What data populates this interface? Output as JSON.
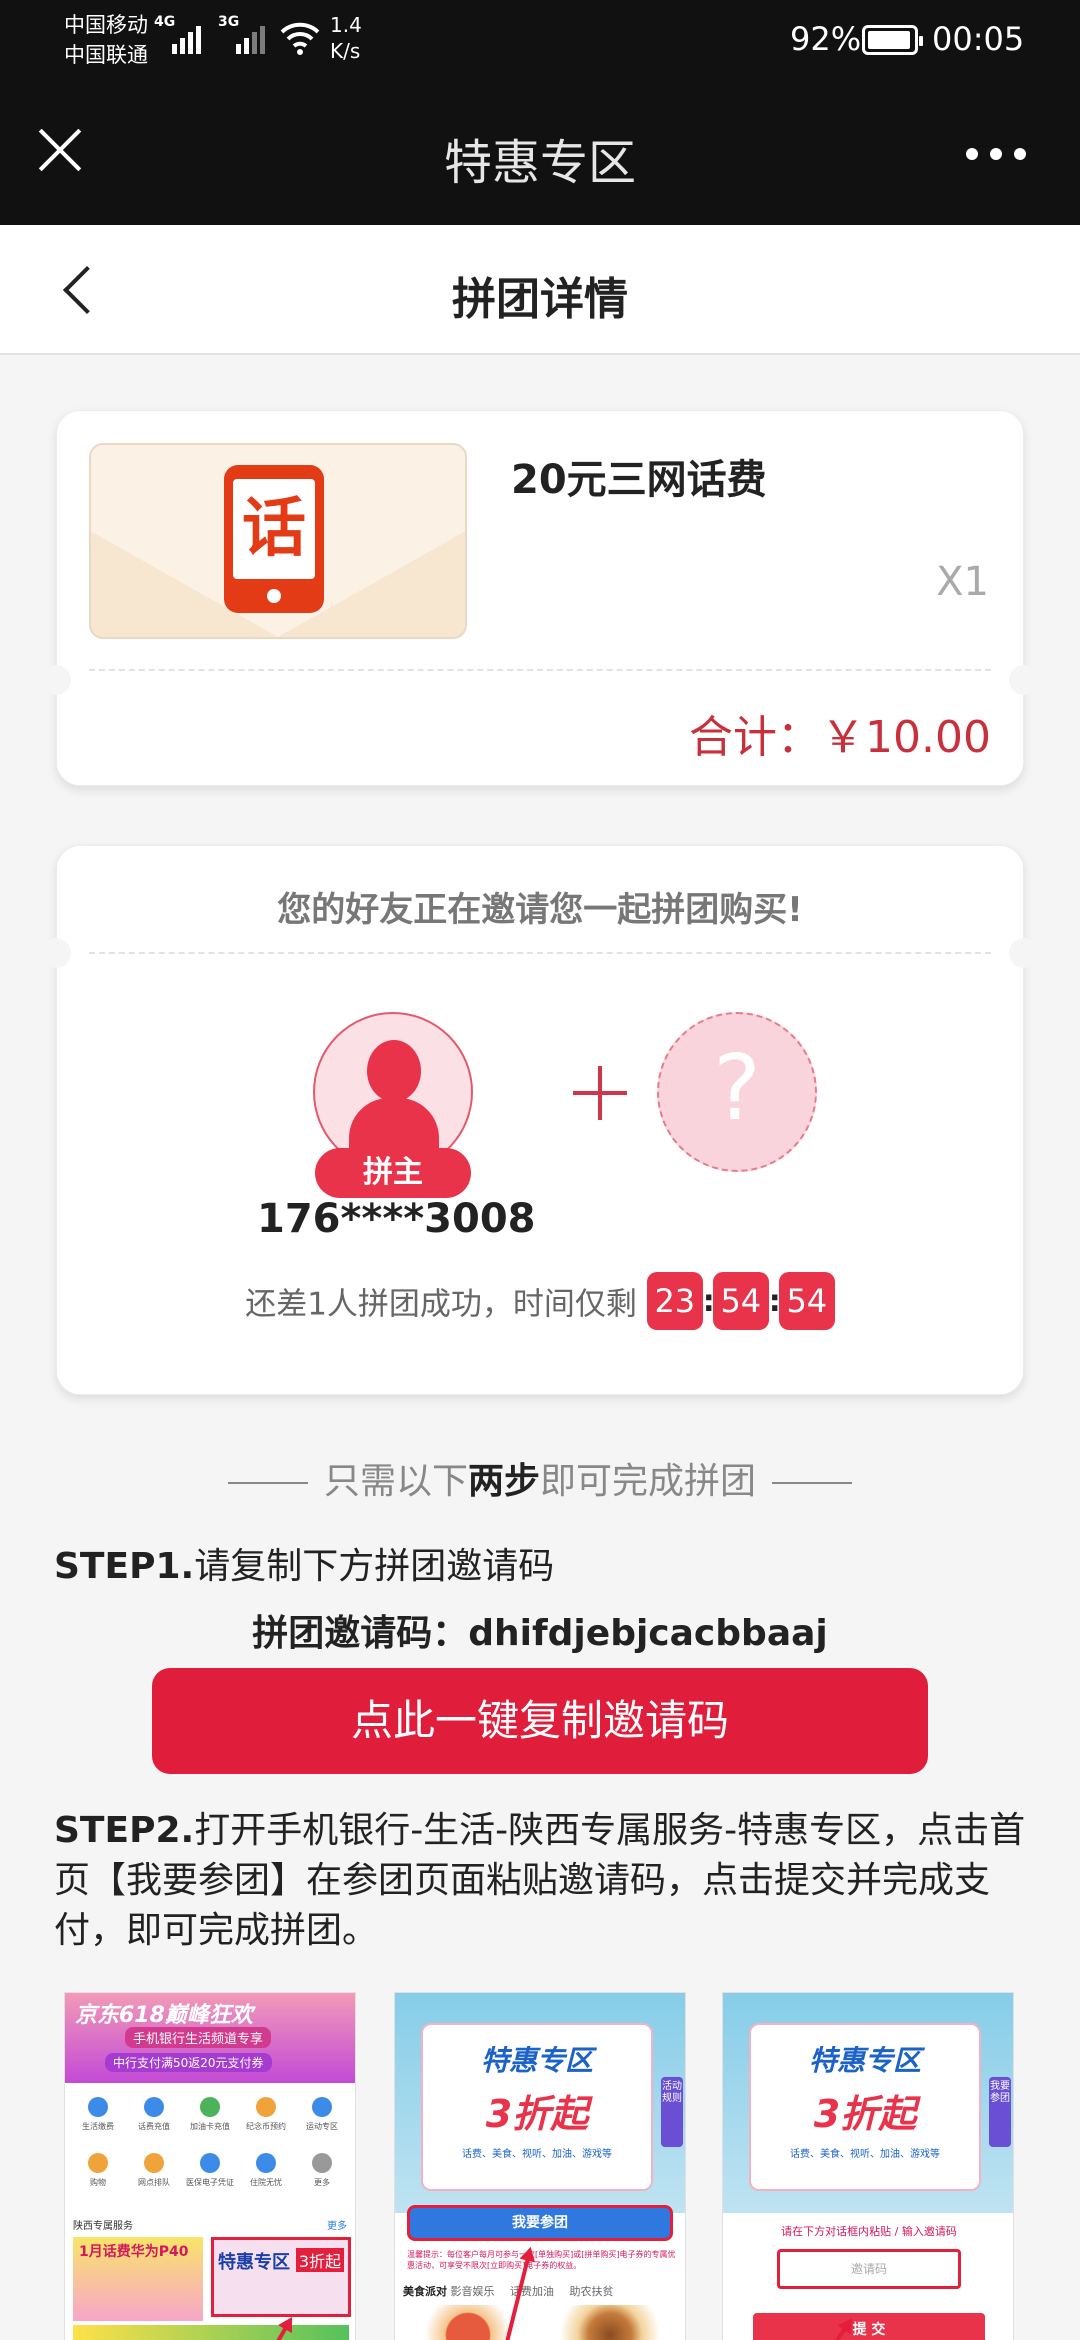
{
  "status_bar": {
    "carrier_1": "中国移动",
    "carrier_2": "中国联通",
    "network_1": "4G",
    "network_2": "3G",
    "speed_value": "1.4",
    "speed_unit": "K/s",
    "battery": "92%",
    "time": "00:05"
  },
  "app_header": {
    "title": "特惠专区"
  },
  "page_header": {
    "title": "拼团详情"
  },
  "product": {
    "name": "20元三网话费",
    "image_char": "话",
    "quantity": "X1",
    "total": "合计：￥10.00"
  },
  "group": {
    "invite_text": "您的好友正在邀请您一起拼团购买!",
    "leader_badge": "拼主",
    "leader_phone": "176****3008",
    "empty_slot": "?",
    "countdown_label": "还差1人拼团成功，时间仅剩",
    "countdown": {
      "hours": "23",
      "minutes": "54",
      "seconds": "54"
    }
  },
  "steps": {
    "heading_pre": "只需以下",
    "heading_bold": "两步",
    "heading_post": "即可完成拼团",
    "step1_label": "STEP1.",
    "step1_text": "请复制下方拼团邀请码",
    "invite_code_label": "拼团邀请码：",
    "invite_code": "dhifdjebjcacbbaaj",
    "copy_button": "点此一键复制邀请码",
    "step2_label": "STEP2.",
    "step2_text": "打开手机银行-生活-陕西专属服务-特惠专区，点击首页【我要参团】在参团页面粘贴邀请码，点击提交并完成支付，即可完成拼团。"
  },
  "screenshots": {
    "shot1": {
      "banner_title": "京东618巅峰狂欢",
      "banner_sub": "手机银行生活频道专享",
      "banner_sub2": "中行支付满50返20元支付券",
      "grid": [
        "生活缴费",
        "话费充值",
        "加油卡充值",
        "纪念币预约",
        "运动专区",
        "购物",
        "网点排队",
        "医保电子凭证",
        "住院无忧",
        "更多"
      ],
      "section": "陕西专属服务",
      "more": "更多",
      "banner2": "1月话费华为P40",
      "banner3_a": "特惠专区",
      "banner3_b": "3折起"
    },
    "shot2": {
      "title_a": "特惠专区",
      "title_b": "3折起",
      "subtitle": "话费、美食、视听、加油、游戏等",
      "side_tag": "活动规则",
      "join_button": "我要参团",
      "tip": "温馨提示：每位客户每月可参与一次[单独购买]或[拼单购买]电子券的专属优惠活动，可享受不限次[立即购买]电子券的权益。",
      "tabs": [
        "美食派对",
        "影音娱乐",
        "话费加油",
        "助农扶贫"
      ]
    },
    "shot3": {
      "title_a": "特惠专区",
      "title_b": "3折起",
      "subtitle": "话费、美食、视听、加油、游戏等",
      "side_tag": "我要参团",
      "paste_hint": "请在下方对话框内粘贴 / 输入邀请码",
      "input_placeholder": "邀请码",
      "submit": "提 交"
    }
  },
  "colors": {
    "accent_red": "#e01e3c",
    "price_red": "#c8313c",
    "header_bg": "#111111"
  }
}
